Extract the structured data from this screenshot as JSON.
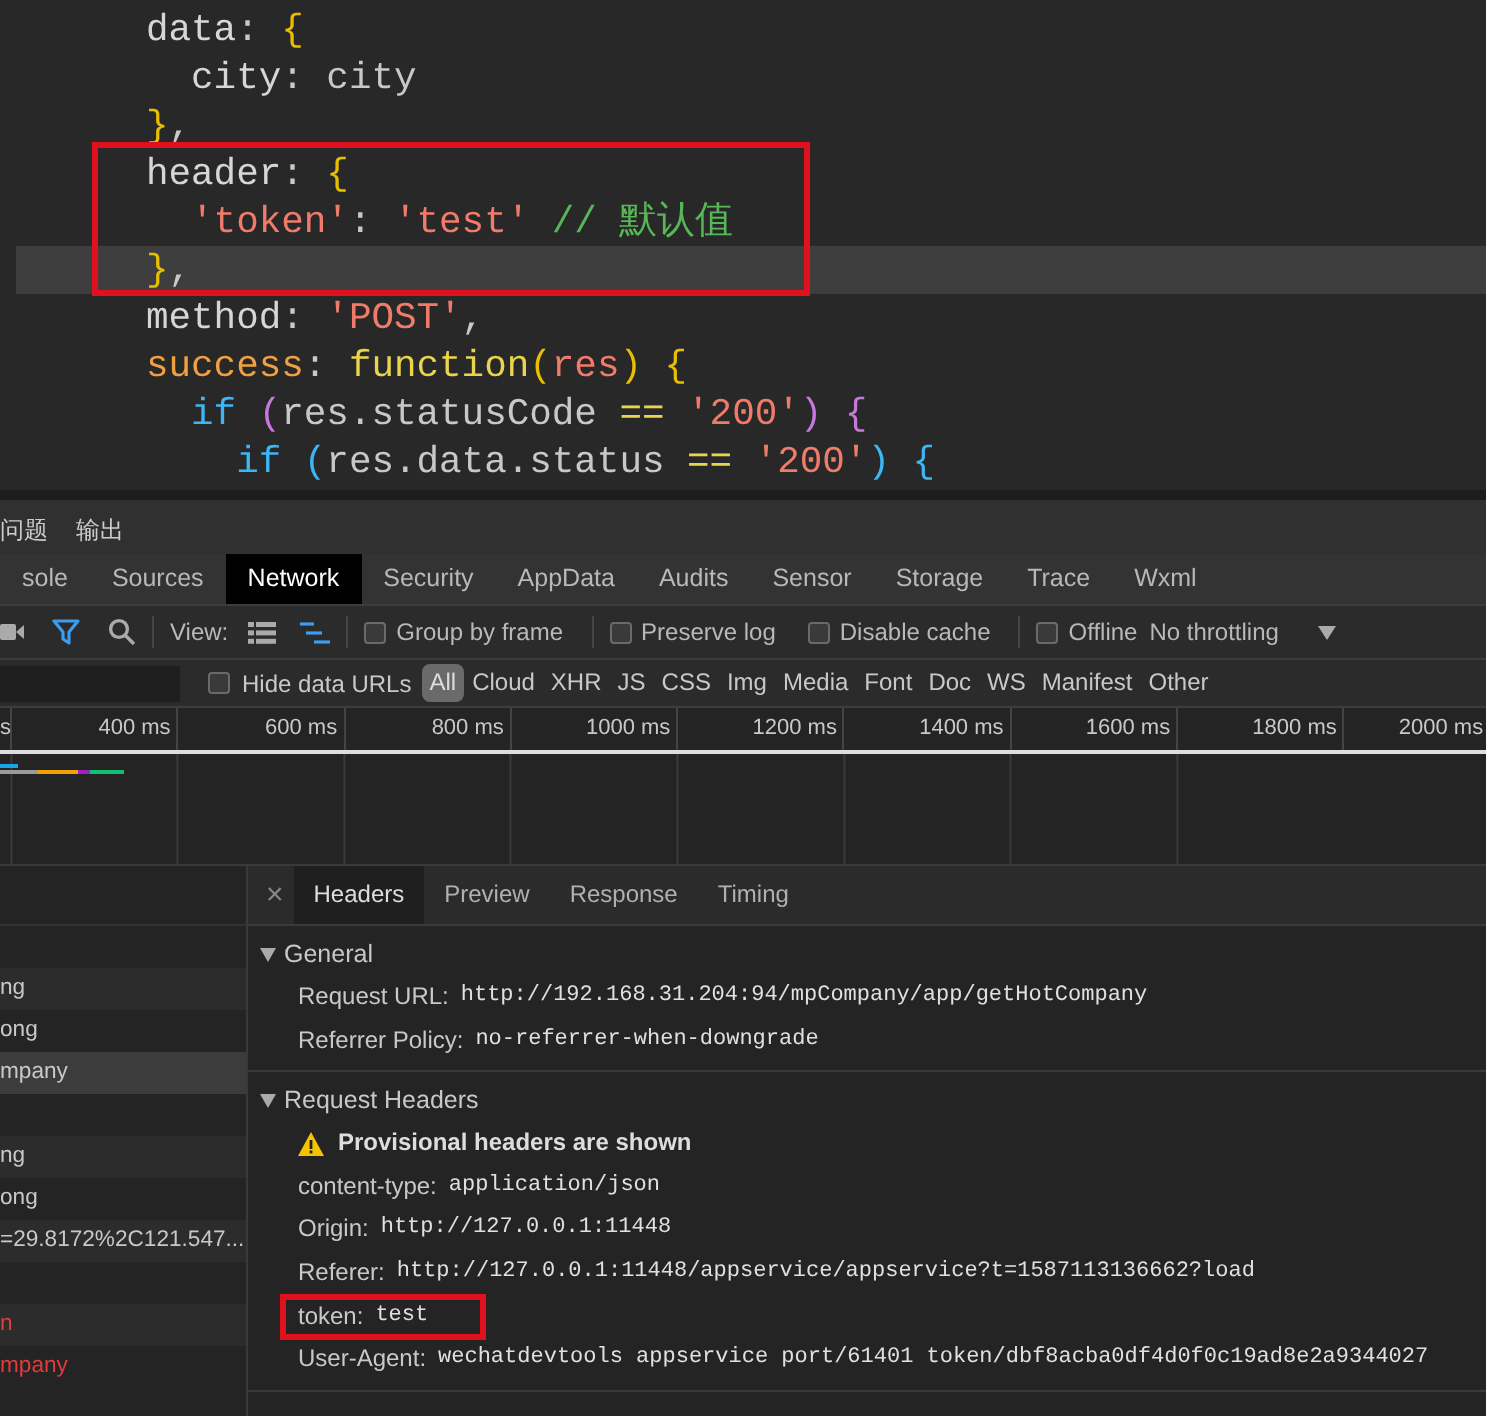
{
  "editor": {
    "lines": [
      {
        "current": false,
        "boxed": false,
        "tokens": [
          {
            "kind": "key",
            "text": "data"
          },
          {
            "kind": "punct",
            "text": ": "
          },
          {
            "kind": "brace",
            "text": "{"
          }
        ]
      },
      {
        "current": false,
        "boxed": false,
        "tokens": [
          {
            "kind": "key",
            "text": "  city"
          },
          {
            "kind": "punct",
            "text": ": "
          },
          {
            "kind": "plain",
            "text": "city"
          }
        ]
      },
      {
        "current": false,
        "boxed": false,
        "tokens": [
          {
            "kind": "brace",
            "text": "}"
          },
          {
            "kind": "punct",
            "text": ","
          }
        ]
      },
      {
        "current": false,
        "boxed": true,
        "tokens": [
          {
            "kind": "key",
            "text": "header"
          },
          {
            "kind": "punct",
            "text": ": "
          },
          {
            "kind": "brace",
            "text": "{"
          }
        ]
      },
      {
        "current": false,
        "boxed": true,
        "tokens": [
          {
            "kind": "string",
            "text": "  'token'"
          },
          {
            "kind": "punct",
            "text": ": "
          },
          {
            "kind": "string",
            "text": "'test'"
          },
          {
            "kind": "comment",
            "text": " // 默认值"
          }
        ]
      },
      {
        "current": true,
        "boxed": true,
        "tokens": [
          {
            "kind": "brace",
            "text": "}"
          },
          {
            "kind": "punct",
            "text": ","
          }
        ]
      },
      {
        "current": false,
        "boxed": false,
        "tokens": [
          {
            "kind": "key",
            "text": "method"
          },
          {
            "kind": "punct",
            "text": ": "
          },
          {
            "kind": "string",
            "text": "'POST'"
          },
          {
            "kind": "punct",
            "text": ","
          }
        ]
      },
      {
        "current": false,
        "boxed": false,
        "tokens": [
          {
            "kind": "prop",
            "text": "success"
          },
          {
            "kind": "punct",
            "text": ": "
          },
          {
            "kind": "func",
            "text": "function"
          },
          {
            "kind": "brace",
            "text": "("
          },
          {
            "kind": "param",
            "text": "res"
          },
          {
            "kind": "brace",
            "text": ")"
          },
          {
            "kind": "brace",
            "text": " {"
          }
        ]
      },
      {
        "current": false,
        "boxed": false,
        "tokens": [
          {
            "kind": "keyword",
            "text": "  if"
          },
          {
            "kind": "paren",
            "text": " ("
          },
          {
            "kind": "plain",
            "text": "res.statusCode"
          },
          {
            "kind": "op",
            "text": " == "
          },
          {
            "kind": "string",
            "text": "'200'"
          },
          {
            "kind": "paren",
            "text": ") {"
          }
        ]
      },
      {
        "current": false,
        "boxed": false,
        "tokens": [
          {
            "kind": "keyword",
            "text": "    if"
          },
          {
            "kind": "keyword",
            "text": " ("
          },
          {
            "kind": "plain",
            "text": "res.data.status"
          },
          {
            "kind": "op",
            "text": " == "
          },
          {
            "kind": "string",
            "text": "'200'"
          },
          {
            "kind": "keyword",
            "text": ") {"
          }
        ]
      }
    ]
  },
  "panel_tabs": [
    {
      "label": "问题"
    },
    {
      "label": "输出"
    }
  ],
  "devtools_tabs": [
    {
      "label": "sole",
      "selected": false
    },
    {
      "label": "Sources",
      "selected": false
    },
    {
      "label": "Network",
      "selected": true
    },
    {
      "label": "Security",
      "selected": false
    },
    {
      "label": "AppData",
      "selected": false
    },
    {
      "label": "Audits",
      "selected": false
    },
    {
      "label": "Sensor",
      "selected": false
    },
    {
      "label": "Storage",
      "selected": false
    },
    {
      "label": "Trace",
      "selected": false
    },
    {
      "label": "Wxml",
      "selected": false
    }
  ],
  "toolbar": {
    "filter_on": true,
    "view_label": "View:",
    "large_rows": false,
    "overview_on": true,
    "checkbox_groups": [
      [
        {
          "label": "Group by frame",
          "checked": false
        }
      ],
      [
        {
          "label": "Preserve log",
          "checked": false
        },
        {
          "label": "Disable cache",
          "checked": false
        }
      ],
      [
        {
          "label": "Offline",
          "checked": false
        }
      ]
    ],
    "throttling": "No throttling"
  },
  "filter": {
    "hide_data_urls": {
      "label": "Hide data URLs",
      "checked": false
    },
    "types": [
      {
        "label": "All",
        "selected": true
      },
      {
        "label": "Cloud",
        "selected": false
      },
      {
        "label": "XHR",
        "selected": false
      },
      {
        "label": "JS",
        "selected": false
      },
      {
        "label": "CSS",
        "selected": false
      },
      {
        "label": "Img",
        "selected": false
      },
      {
        "label": "Media",
        "selected": false
      },
      {
        "label": "Font",
        "selected": false
      },
      {
        "label": "Doc",
        "selected": false
      },
      {
        "label": "WS",
        "selected": false
      },
      {
        "label": "Manifest",
        "selected": false
      },
      {
        "label": "Other",
        "selected": false
      }
    ]
  },
  "timeline": {
    "ticks": [
      "s",
      "400 ms",
      "600 ms",
      "800 ms",
      "1000 ms",
      "1200 ms",
      "1400 ms",
      "1600 ms",
      "1800 ms",
      "2000 ms"
    ]
  },
  "requests": [
    {
      "kind": "blank"
    },
    {
      "kind": "request",
      "name": "ng",
      "selected": false,
      "error": false
    },
    {
      "kind": "request",
      "name": "ong",
      "selected": false,
      "error": false
    },
    {
      "kind": "request",
      "name": "mpany",
      "selected": true,
      "error": false
    },
    {
      "kind": "blank"
    },
    {
      "kind": "request",
      "name": "ng",
      "selected": false,
      "error": false
    },
    {
      "kind": "request",
      "name": "ong",
      "selected": false,
      "error": false
    },
    {
      "kind": "request",
      "name": "=29.8172%2C121.547...",
      "selected": false,
      "error": false
    },
    {
      "kind": "blank"
    },
    {
      "kind": "request",
      "name": "n",
      "selected": false,
      "error": true
    },
    {
      "kind": "request",
      "name": "mpany",
      "selected": false,
      "error": true
    }
  ],
  "details": {
    "close": "×",
    "tabs": [
      {
        "label": "Headers",
        "selected": true
      },
      {
        "label": "Preview",
        "selected": false
      },
      {
        "label": "Response",
        "selected": false
      },
      {
        "label": "Timing",
        "selected": false
      }
    ],
    "sections": [
      {
        "title": "General",
        "expanded": true,
        "rows": [
          {
            "kind": "field",
            "key": "Request URL:",
            "value": "http://192.168.31.204:94/mpCompany/app/getHotCompany"
          },
          {
            "kind": "field",
            "key": "Referrer Policy:",
            "value": "no-referrer-when-downgrade"
          }
        ]
      },
      {
        "title": "Request Headers",
        "expanded": true,
        "rows": [
          {
            "kind": "warning",
            "text": "Provisional headers are shown"
          },
          {
            "kind": "field",
            "key": "content-type:",
            "value": "application/json"
          },
          {
            "kind": "field",
            "key": "Origin:",
            "value": "http://127.0.0.1:11448"
          },
          {
            "kind": "field",
            "key": "Referer:",
            "value": "http://127.0.0.1:11448/appservice/appservice?t=1587113136662?load"
          },
          {
            "kind": "field",
            "key": "token:",
            "value": "test",
            "boxed": true
          },
          {
            "kind": "field",
            "key": "User-Agent:",
            "value": "wechatdevtools appservice port/61401 token/dbf8acba0df4d0f0c19ad8e2a9344027"
          }
        ]
      }
    ]
  }
}
